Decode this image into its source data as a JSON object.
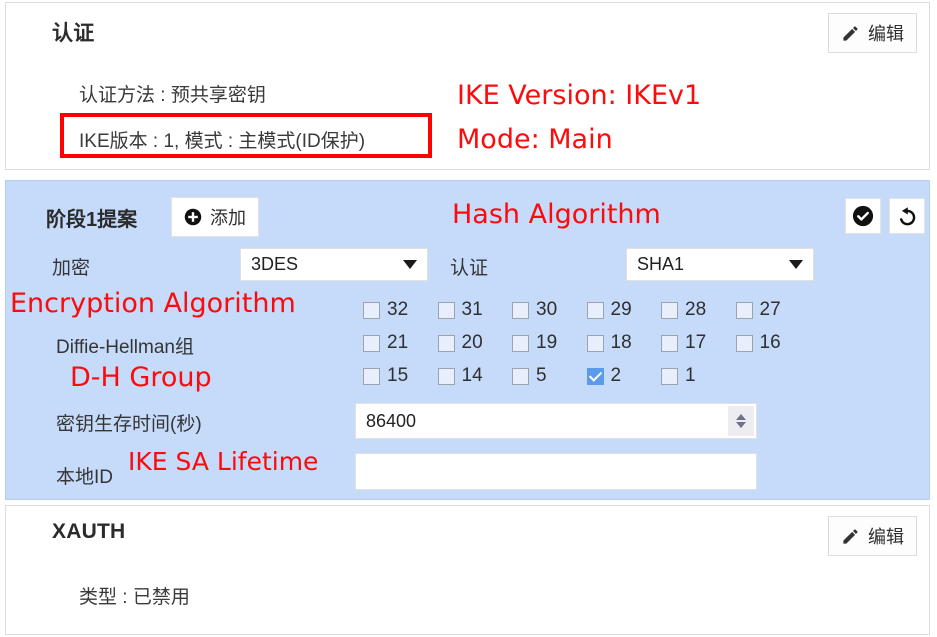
{
  "sections": {
    "auth": {
      "title": "认证",
      "edit_label": "编辑",
      "method_line": "认证方法 : 预共享密钥",
      "version_line": "IKE版本 : 1, 模式 : 主模式(ID保护)"
    },
    "xauth": {
      "title": "XAUTH",
      "edit_label": "编辑",
      "type_line": "类型 : 已禁用"
    }
  },
  "proposal_panel": {
    "heading": "阶段1提案",
    "add_label": "添加",
    "apply_icon": "check-circle-icon",
    "revert_icon": "undo-icon",
    "encryption": {
      "label": "加密",
      "value": "3DES"
    },
    "authentication": {
      "label": "认证",
      "value": "SHA1"
    },
    "dh_group": {
      "label": "Diffie-Hellman组",
      "rows": [
        [
          {
            "label": "32",
            "checked": false
          },
          {
            "label": "31",
            "checked": false
          },
          {
            "label": "30",
            "checked": false
          },
          {
            "label": "29",
            "checked": false
          },
          {
            "label": "28",
            "checked": false
          },
          {
            "label": "27",
            "checked": false
          }
        ],
        [
          {
            "label": "21",
            "checked": false
          },
          {
            "label": "20",
            "checked": false
          },
          {
            "label": "19",
            "checked": false
          },
          {
            "label": "18",
            "checked": false
          },
          {
            "label": "17",
            "checked": false
          },
          {
            "label": "16",
            "checked": false
          }
        ],
        [
          {
            "label": "15",
            "checked": false
          },
          {
            "label": "14",
            "checked": false
          },
          {
            "label": "5",
            "checked": false
          },
          {
            "label": "2",
            "checked": true
          },
          {
            "label": "1",
            "checked": false
          }
        ]
      ]
    },
    "lifetime": {
      "label": "密钥生存时间(秒)",
      "value": "86400"
    },
    "local_id": {
      "label": "本地ID",
      "value": "",
      "placeholder": ""
    }
  },
  "annotations": {
    "color": "#fb0b0b",
    "ike_version": "IKE Version: IKEv1",
    "mode": "Mode: Main",
    "hash_algorithm": "Hash Algorithm",
    "encryption_algorithm": "Encryption Algorithm",
    "dh_group": "D-H Group",
    "ike_sa_lifetime": "IKE SA Lifetime",
    "highlight_box_target": "IKE版本 : 1, 模式 : 主模式(ID保护)"
  }
}
